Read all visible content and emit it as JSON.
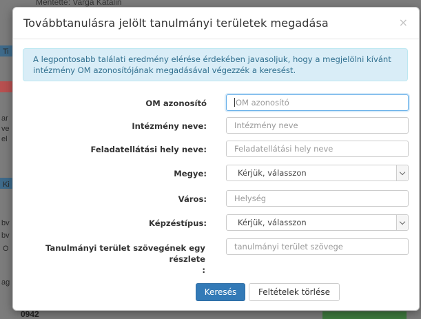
{
  "background": {
    "top_text": "Mentette: Varga Katalin",
    "bottom_text": "0942",
    "left_fragments": [
      "Ti",
      "ar",
      "ve",
      "el",
      "Ki",
      "bv",
      "bv",
      "O",
      "ag"
    ],
    "strip_colors": [
      "#3e6a8a",
      "#b85050",
      "#3e6a8a"
    ]
  },
  "modal": {
    "title": "Továbbtanulásra jelölt tanulmányi területek megadása",
    "close_glyph": "×",
    "info_text": "A legpontosabb találati eredmény elérése érdekében javasoljuk, hogy a megjelölni kívánt intézmény OM azonosítójának megadásával végezzék a keresést."
  },
  "form": {
    "om": {
      "label": "OM azonosító",
      "placeholder": "OM azonosító"
    },
    "intezmeny": {
      "label": "Intézmény neve:",
      "placeholder": "Intézmény neve"
    },
    "feladat": {
      "label": "Feladatellátási hely neve:",
      "placeholder": "Feladatellátási hely neve"
    },
    "megye": {
      "label": "Megye:",
      "value": "Kérjük, válasszon"
    },
    "varos": {
      "label": "Város:",
      "placeholder": "Helység"
    },
    "kepzes": {
      "label": "Képzéstípus:",
      "value": "Kérjük, válasszon"
    },
    "terulet": {
      "label_line1": "Tanulmányi terület szövegének egy",
      "label_line2": "részlete",
      "label_line3": ":",
      "placeholder": "tanulmányi terület szövege"
    }
  },
  "buttons": {
    "search": "Keresés",
    "clear": "Feltételek törlése"
  }
}
